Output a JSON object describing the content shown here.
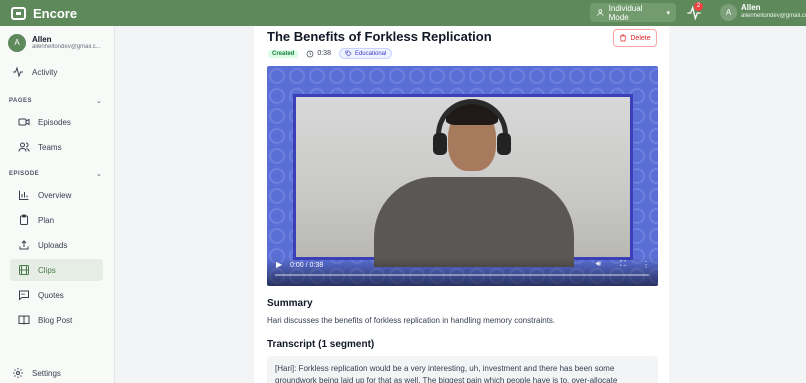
{
  "app": {
    "name": "Encore"
  },
  "topbar": {
    "mode_label": "Individual Mode",
    "notification_count": "2",
    "user_initial": "A",
    "user_name": "Allen",
    "user_email": "allenheltondev@gmail.com"
  },
  "sidebar": {
    "user_initial": "A",
    "user_name": "Allen",
    "user_email": "allenheltondev@gmail.c...",
    "activity_label": "Activity",
    "pages_section": "PAGES",
    "pages": [
      {
        "label": "Episodes",
        "icon": "video-icon"
      },
      {
        "label": "Teams",
        "icon": "users-icon"
      }
    ],
    "episode_section": "EPISODE",
    "episode_items": [
      {
        "label": "Overview",
        "icon": "bar-chart-icon"
      },
      {
        "label": "Plan",
        "icon": "clipboard-icon"
      },
      {
        "label": "Uploads",
        "icon": "upload-icon"
      },
      {
        "label": "Clips",
        "icon": "film-icon",
        "active": true
      },
      {
        "label": "Quotes",
        "icon": "quote-icon"
      },
      {
        "label": "Blog Post",
        "icon": "book-icon"
      }
    ],
    "settings_label": "Settings"
  },
  "clip": {
    "title": "The Benefits of Forkless Replication",
    "status": "Created",
    "duration": "0:38",
    "tag": "Educational",
    "delete_label": "Delete",
    "video": {
      "time_display": "0:00 / 0:38",
      "progress": 0
    },
    "summary_heading": "Summary",
    "summary_text": "Hari discusses the benefits of forkless replication in handling memory constraints.",
    "transcript_heading": "Transcript (1 segment)",
    "transcript_text": "[Hari]: Forkless replication would be a very interesting, uh, investment and there has been some groundwork being laid up for that as well. The biggest pain which people have is to, over-allocate"
  },
  "colors": {
    "brand": "#5e8a5b",
    "danger": "#dc2626",
    "video_bg": "#5a6fd6"
  }
}
